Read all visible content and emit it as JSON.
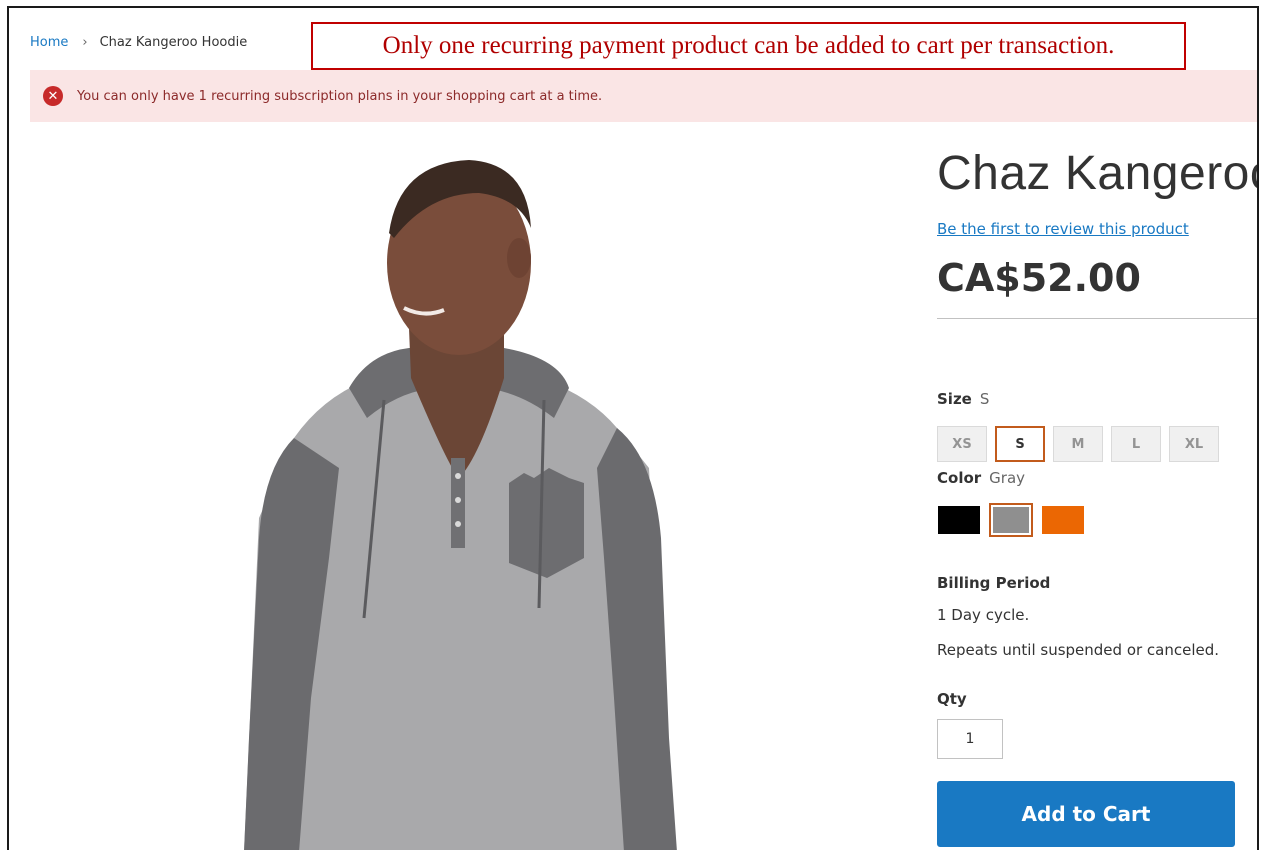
{
  "breadcrumb": {
    "home": "Home",
    "separator": "›",
    "current": "Chaz Kangeroo Hoodie"
  },
  "annotation": {
    "text": "Only one recurring payment product can be added to cart per transaction."
  },
  "message": {
    "icon": "error-icon",
    "text": "You can only have 1 recurring subscription plans in your shopping cart at a time."
  },
  "product": {
    "title": "Chaz Kangeroo Hoodie",
    "review_link": "Be the first to review this product",
    "price": "CA$52.00"
  },
  "options": {
    "size": {
      "label": "Size",
      "selected": "S",
      "values": [
        "XS",
        "S",
        "M",
        "L",
        "XL"
      ]
    },
    "color": {
      "label": "Color",
      "selected": "Gray",
      "swatches": [
        {
          "name": "Black",
          "hex": "#000000"
        },
        {
          "name": "Gray",
          "hex": "#8f8f8f"
        },
        {
          "name": "Orange",
          "hex": "#eb6703"
        }
      ]
    }
  },
  "billing": {
    "label": "Billing Period",
    "cycle": "1 Day cycle.",
    "repeat": "Repeats until suspended or canceled."
  },
  "qty": {
    "label": "Qty",
    "value": "1"
  },
  "add_to_cart": {
    "label": "Add to Cart"
  },
  "colors": {
    "link": "#1979c3",
    "error_bg": "#fae5e5",
    "error_icon": "#c72a2a",
    "annotation_border": "#c00000",
    "selected_border": "#c25b1c",
    "button": "#1979c3"
  }
}
